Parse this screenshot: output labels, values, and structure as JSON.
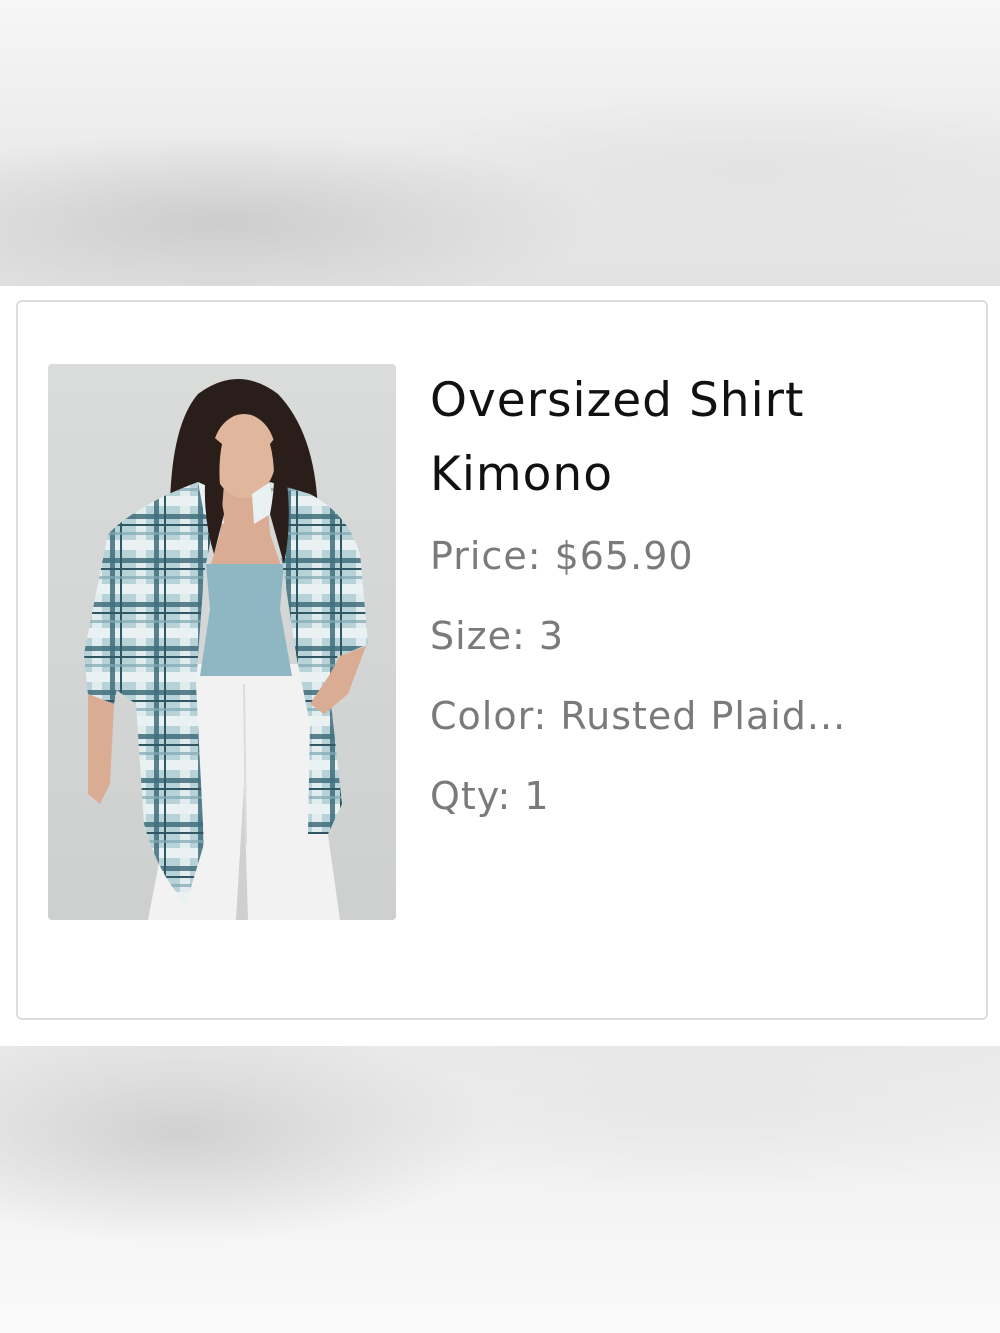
{
  "product": {
    "image_alt": "Model wearing blue plaid oversized shirt kimono over a light blue tank and white jeans",
    "title_line1": "Oversized Shirt",
    "title_line2": "Kimono",
    "price": "Price: $65.90",
    "size": "Size: 3",
    "color": "Color: Rusted Plaid...",
    "qty": "Qty: 1"
  },
  "colors": {
    "title": "#111111",
    "detail_text": "#7a7a7a",
    "card_border": "#dcdcdc",
    "photo_background": "#d6d8d7",
    "plaid_base": "#a9c9cf",
    "plaid_dark": "#3f6f7d",
    "tank": "#8fb6c3",
    "jeans": "#f2f2f2"
  }
}
